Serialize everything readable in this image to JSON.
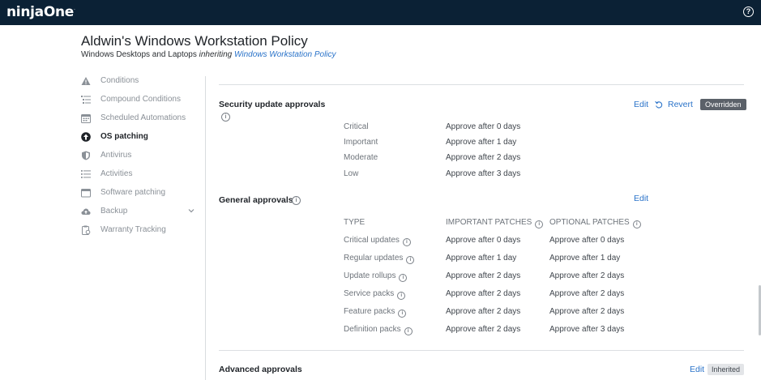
{
  "app": {
    "logo": "ninjaOne",
    "help_label": "?"
  },
  "page": {
    "title": "Aldwin's Windows Workstation Policy",
    "subtitle_prefix": "Windows Desktops and Laptops",
    "subtitle_inheriting": "inheriting",
    "subtitle_link": "Windows Workstation Policy"
  },
  "sidebar": {
    "items": [
      {
        "label": "Conditions",
        "icon": "warning-icon",
        "active": false
      },
      {
        "label": "Compound Conditions",
        "icon": "list-tree-icon",
        "active": false
      },
      {
        "label": "Scheduled Automations",
        "icon": "calendar-icon",
        "active": false
      },
      {
        "label": "OS patching",
        "icon": "arrow-up-circle-icon",
        "active": true
      },
      {
        "label": "Antivirus",
        "icon": "shield-icon",
        "active": false
      },
      {
        "label": "Activities",
        "icon": "list-icon",
        "active": false
      },
      {
        "label": "Software patching",
        "icon": "window-icon",
        "active": false
      },
      {
        "label": "Backup",
        "icon": "cloud-upload-icon",
        "active": false,
        "expandable": true
      },
      {
        "label": "Warranty Tracking",
        "icon": "clipboard-icon",
        "active": false
      }
    ]
  },
  "security": {
    "title": "Security update approvals",
    "edit_label": "Edit",
    "revert_label": "Revert",
    "badge": "Overridden",
    "rows": [
      {
        "label": "Critical",
        "value": "Approve after 0 days"
      },
      {
        "label": "Important",
        "value": "Approve after 1 day"
      },
      {
        "label": "Moderate",
        "value": "Approve after 2 days"
      },
      {
        "label": "Low",
        "value": "Approve after 3 days"
      }
    ]
  },
  "general": {
    "title": "General approvals",
    "edit_label": "Edit",
    "headers": [
      "TYPE",
      "IMPORTANT PATCHES",
      "OPTIONAL PATCHES"
    ],
    "rows": [
      {
        "type": "Critical updates",
        "important": "Approve after 0 days",
        "optional": "Approve after 0 days"
      },
      {
        "type": "Regular updates",
        "important": "Approve after 1 day",
        "optional": "Approve after 1 day"
      },
      {
        "type": "Update rollups",
        "important": "Approve after 2 days",
        "optional": "Approve after 2 days"
      },
      {
        "type": "Service packs",
        "important": "Approve after 2 days",
        "optional": "Approve after 2 days"
      },
      {
        "type": "Feature packs",
        "important": "Approve after 2 days",
        "optional": "Approve after 2 days"
      },
      {
        "type": "Definition packs",
        "important": "Approve after 2 days",
        "optional": "Approve after 3 days"
      }
    ]
  },
  "advanced": {
    "title": "Advanced approvals",
    "edit_label": "Edit",
    "badge": "Inherited"
  },
  "colors": {
    "topbar": "#0b2135",
    "link": "#2a73c9",
    "badge_overridden": "#5b6169",
    "badge_inherited": "#e3e5e8"
  }
}
